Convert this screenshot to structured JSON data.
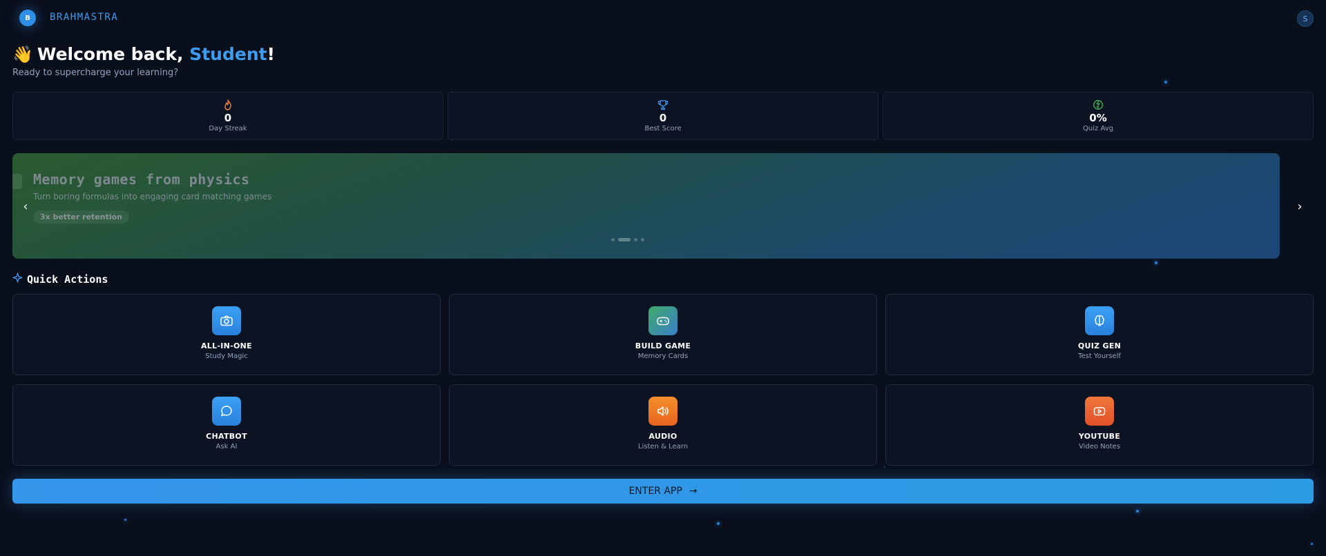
{
  "header": {
    "logo_letter": "B",
    "brand": "BRAHMASTRA",
    "user_initial": "S"
  },
  "welcome": {
    "greeting": "Welcome back, ",
    "name": "Student",
    "exclaim": "!",
    "emoji": "👋",
    "subtitle": "Ready to supercharge your learning?"
  },
  "stats": [
    {
      "icon": "flame-icon",
      "value": "0",
      "label": "Day Streak",
      "color": "#f0883e"
    },
    {
      "icon": "trophy-icon",
      "value": "0",
      "label": "Best Score",
      "color": "#3d9bf0"
    },
    {
      "icon": "brain-icon",
      "value": "0%",
      "label": "Quiz Avg",
      "color": "#3fb950"
    }
  ],
  "carousel": {
    "title": "Memory games from physics",
    "description": "Turn boring formulas into engaging card matching games",
    "badge": "3x better retention",
    "prev": "‹",
    "next": "›",
    "active_slide": 2,
    "slide_count": 4
  },
  "quick_actions": {
    "title": "Quick Actions",
    "items": [
      {
        "title": "ALL-IN-ONE",
        "subtitle": "Study Magic",
        "icon": "camera-icon",
        "color": "#2f8fe6"
      },
      {
        "title": "BUILD GAME",
        "subtitle": "Memory Cards",
        "icon": "gamepad-icon",
        "color": "#3fa07a"
      },
      {
        "title": "QUIZ GEN",
        "subtitle": "Test Yourself",
        "icon": "brain-icon",
        "color": "#2f8fe6"
      },
      {
        "title": "CHATBOT",
        "subtitle": "Ask AI",
        "icon": "chat-icon",
        "color": "#2f8fe6"
      },
      {
        "title": "AUDIO",
        "subtitle": "Listen & Learn",
        "icon": "speaker-icon",
        "color": "#f07a2a"
      },
      {
        "title": "YOUTUBE",
        "subtitle": "Video Notes",
        "icon": "youtube-icon",
        "color": "#f06a2a"
      }
    ]
  },
  "cta": {
    "label": "ENTER APP",
    "arrow": "→"
  }
}
